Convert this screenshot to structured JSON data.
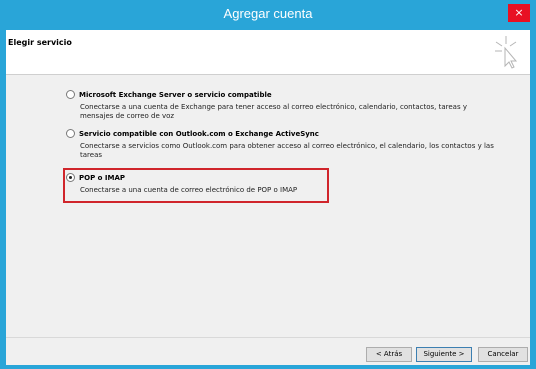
{
  "window": {
    "title": "Agregar cuenta",
    "close_glyph": "×"
  },
  "header": {
    "title": "Elegir servicio"
  },
  "options": [
    {
      "label": "Microsoft Exchange Server o servicio compatible",
      "description_line1": "Conectarse a una cuenta de Exchange para tener acceso al correo electrónico, calendario, contactos, tareas y",
      "description_line2": "mensajes de correo de voz",
      "selected": false
    },
    {
      "label": "Servicio compatible con Outlook.com o Exchange ActiveSync",
      "description_line1": "Conectarse a servicios como Outlook.com para obtener acceso al correo electrónico, el calendario, los contactos y las",
      "description_line2": "tareas",
      "selected": false
    },
    {
      "label": "POP o IMAP",
      "description_line1": "Conectarse a una cuenta de correo electrónico de POP o IMAP",
      "selected": true
    }
  ],
  "footer": {
    "back_label": "< Atrás",
    "next_label": "Siguiente >",
    "cancel_label": "Cancelar"
  },
  "colors": {
    "titlebar": "#29a5d8",
    "close": "#e81123",
    "highlight": "#d0252b"
  }
}
